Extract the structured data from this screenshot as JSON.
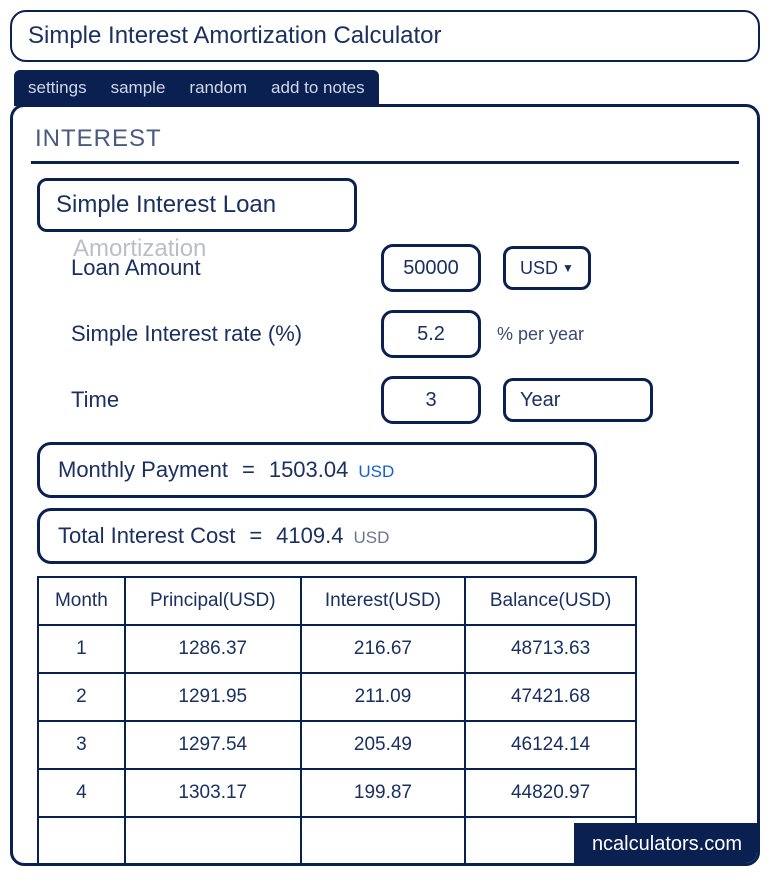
{
  "title": "Simple Interest Amortization Calculator",
  "tabs": {
    "settings": "settings",
    "sample": "sample",
    "random": "random",
    "notes": "add to notes"
  },
  "section": "INTEREST",
  "loan_type": "Simple Interest Loan",
  "ghost": "Amortization",
  "form": {
    "amount_label": "Loan Amount",
    "amount_value": "50000",
    "currency": "USD",
    "rate_label": "Simple Interest rate (%)",
    "rate_value": "5.2",
    "rate_unit": "% per year",
    "time_label": "Time",
    "time_value": "3",
    "time_unit": "Year"
  },
  "results": {
    "monthly_label": "Monthly Payment",
    "monthly_value": "1503.04",
    "monthly_cur": "USD",
    "total_label": "Total Interest Cost",
    "total_value": "4109.4",
    "total_cur": "USD",
    "eq": "="
  },
  "table": {
    "headers": {
      "month": "Month",
      "principal": "Principal(USD)",
      "interest": "Interest(USD)",
      "balance": "Balance(USD)"
    },
    "rows": [
      {
        "month": "1",
        "principal": "1286.37",
        "interest": "216.67",
        "balance": "48713.63"
      },
      {
        "month": "2",
        "principal": "1291.95",
        "interest": "211.09",
        "balance": "47421.68"
      },
      {
        "month": "3",
        "principal": "1297.54",
        "interest": "205.49",
        "balance": "46124.14"
      },
      {
        "month": "4",
        "principal": "1303.17",
        "interest": "199.87",
        "balance": "44820.97"
      }
    ]
  },
  "brand": "ncalculators.com"
}
